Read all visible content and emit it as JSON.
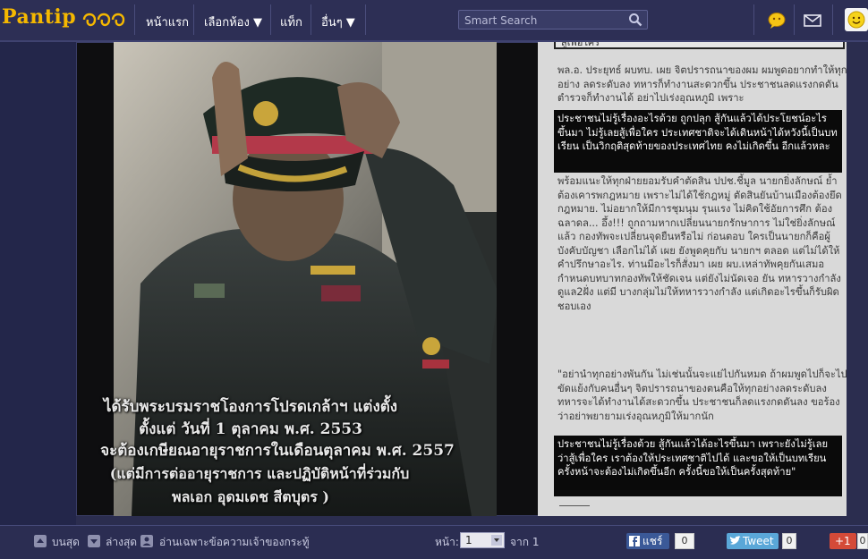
{
  "header": {
    "logo": "Pantip",
    "nav": [
      "หน้าแรก",
      "เลือกห้อง ▼",
      "แท็ก",
      "อื่นๆ ▼"
    ],
    "search_placeholder": "Smart Search"
  },
  "image": {
    "caption": [
      "ได้รับพระบรมราชโองการโปรดเกล้าฯ  แต่งตั้ง",
      "ตั้งแต่ วันที่ 1 ตุลาคม พ.ศ. 2553",
      "จะต้องเกษียณอายุราชการในเดือนตุลาคม พ.ศ. 2557",
      "(แต่มีการต่ออายุราชการ และปฏิบัติหน้าที่ร่วมกับ",
      "พลเอก อุดมเดช สีตบุตร )"
    ]
  },
  "article": {
    "tab_label": "สู่เพื่อใคร",
    "para1": "พล.อ. ประยุทธ์ ผบทบ. เผย จิตปรารถนาของผม ผมพูดอยากทำให้ทุกอย่าง ลดระดับลง ทหารก็ทำงานสะดวกขึ้น ประชาชนลดแรงกดดัน ตำรวจก็ทำงานได้ อย่าไปเร่งอุณหภูมิ เพราะ",
    "highlight1": "ประชาชนไม่รู้เรื่องอะไรด้วย ถูกปลุก สู้กันแล้วได้ประโยชน์อะไรขึ้นมา ไม่รู้เลยสู้เพื่อใคร ประเทศชาติจะได้เดินหน้าได้หวังนี้เป็นบทเรียน เป็นวิกฤติสุดท้ายของประเทศไทย คงไม่เกิดขึ้น อีกแล้วหละ",
    "para2": "พร้อมแนะให้ทุกฝ่ายยอมรับคำตัดสิน ปปช.ชี้มูล นายกยิ่งลักษณ์ ย้ำต้องเคารพกฎหมาย เพราะไม่ได้ใช้กฎหมู่ ตัดสินยันบ้านเมืองต้องยึดกฎหมาย. ไม่อยากให้มีการชุมนุม รุนแรง ไม่คิดใช้อัยการศึก ต้องฉลาดล... อึ้ง!!! ถูกถามหากเปลี่ยนนายกรักษาการ ไม่ใช่ยิ่งลักษณ์ แล้ว กองทัพจะเปลี่ยนจุดยืนหรือไม่ ก่อนตอบ ใครเป็นนายกก็คือผู้บังคับบัญชา เลือกไม่ได้ เผย ยังพูดคุยกับ นายกฯ ตลอด แต่ไม่ได้ให้คำปรึกษาอะไร. ท่านมีอะไรก็สั่งมา เผย ผบ.เหล่าทัพคุยกันเสมอ กำหนดบทบาทกองทัพให้ชัดเจน แต่ยังไม่นัดเจอ ยัน ทหารวางกำลังดูแล2ฝั่ง แต่มี บางกลุ่มไม่ให้ทหารวางกำลัง แต่เกิดอะไรขึ้นก็รับผิดชอบเอง",
    "para3": "\"อย่านำทุกอย่างพันกัน ไม่เช่นนั้นจะแย่ไปกันหมด ถ้าผมพูดไปก็จะไปขัดแย้งกับคนอื่นๆ จิตปรารถนาของตนคือให้ทุกอย่างลดระดับลง ทหารจะได้ทำงานได้สะดวกขึ้น ประชาชนก็ลดแรงกดดันลง ขอร้องว่าอย่าพยายามเร่งอุณหภูมิให้มากนัก",
    "highlight2": "ประชาชนไม่รู้เรื่องด้วย สู้กันแล้วได้อะไรขึ้นมา เพราะยังไม่รู้เลยว่าสู้เพื่อใคร เราต้องให้ประเทศชาติไปได้ และขอให้เป็นบทเรียน ครั้งหน้าจะต้องไม่เกิดขึ้นอีก ครั้งนี้ขอให้เป็นครั้งสุดท้าย\""
  },
  "footer": {
    "top_label": "บนสุด",
    "bottom_label": "ล่างสุด",
    "owner_only_label": "อ่านเฉพาะข้อความเจ้าของกระทู้",
    "page_label": "หน้า:",
    "page_value": "1",
    "page_total": "จาก 1",
    "fb_share": "แชร์",
    "fb_count": "0",
    "tweet": "Tweet",
    "tweet_count": "0",
    "gplus": "+1",
    "gplus_count": "0"
  }
}
